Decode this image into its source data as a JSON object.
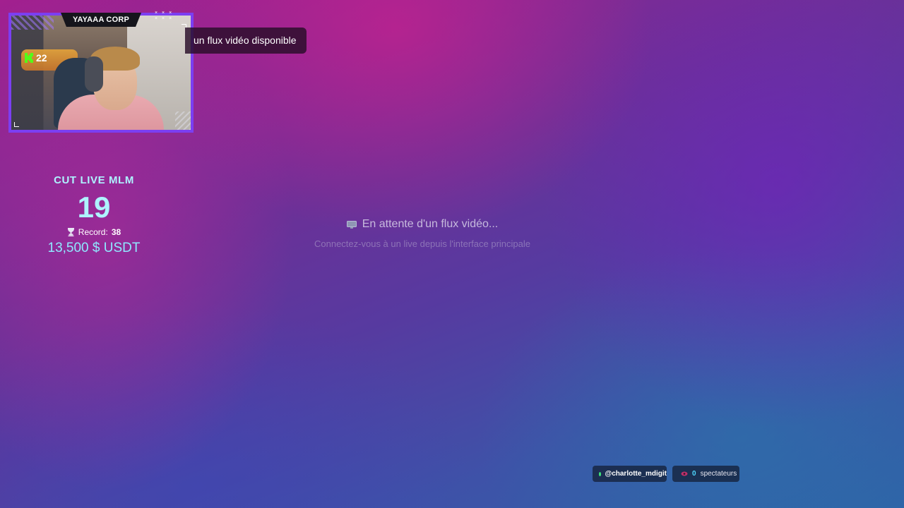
{
  "webcam": {
    "channel_name": "YAYAAA CORP",
    "kick_count": "22",
    "kick_icon": "kick-logo-icon",
    "deco_dots": "× × ×\n× × ×"
  },
  "notification": {
    "text": "un flux vidéo disponible"
  },
  "counter": {
    "title": "CUT LIVE MLM",
    "value": "19",
    "record_label": "Record:",
    "record_value": "38",
    "amount": "13,500 $ USDT",
    "trophy_icon": "trophy-icon"
  },
  "stream": {
    "waiting_text": "En attente d'un flux vidéo...",
    "hint_text": "Connectez-vous à un live depuis l'interface principale",
    "monitor_icon": "monitor-icon"
  },
  "status": {
    "username": "@charlotte_mdigit",
    "viewer_count": "0",
    "viewer_label": "spectateurs",
    "live_color": "#3ee27a",
    "viewer_color": "#4fd8ff"
  },
  "colors": {
    "accent": "#7b3ff2",
    "counter_text": "#aef3ff",
    "kick_green": "#53fc18"
  }
}
